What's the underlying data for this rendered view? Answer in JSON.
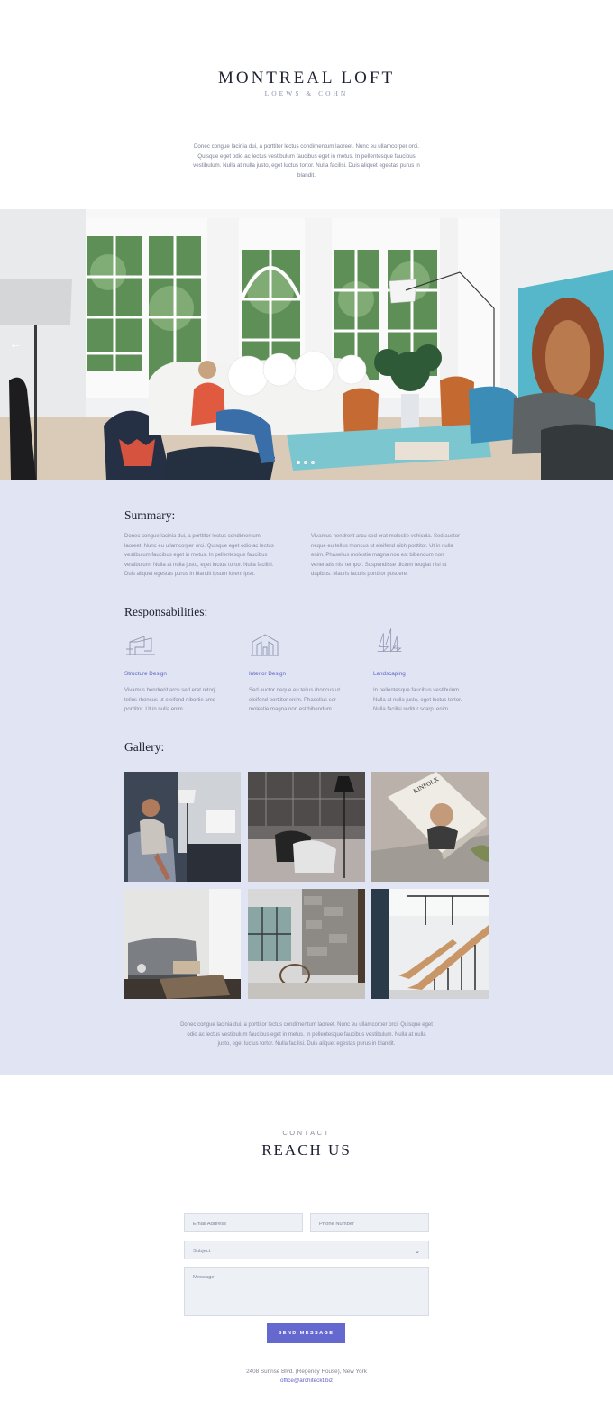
{
  "header": {
    "title": "MONTREAL LOFT",
    "subtitle": "LOEWS & COHN",
    "intro": "Donec congue lacinia dui, a porttitor lectus condimentum laoreet. Nunc eu ullamcorper orci. Quisque eget odio ac lectus vestibulum faucibus eget in metus. In pellentesque faucibus vestibulum. Nulla at nulla justo, eget luctus tortor. Nulla facilisi. Duis aliquet egestas purus in blandit."
  },
  "hero": {
    "prev_icon": "arrow-left-icon",
    "slide_count": 3,
    "active_slide": 1
  },
  "summary": {
    "heading": "Summary:",
    "col1": "Donec congue lacinia dui, a porttitor lectus condimentum laoreet. Nunc eu ullamcorper orci. Quisque eget odio ac lectus vestibulum faucibus eget in metus. In pellentesque faucibus vestibulum. Nulla at nulla justo, eget luctus tortor. Nulla facilisi. Duis aliquet egestas purus in blandit ipsum lorem ipsu.",
    "col2": "Vivamus hendrerit arcu sed erat molestie vehicula. Sed auctor neque eu tellus rhoncus ut eleifend nibh porttitor. Ut in nulla enim. Phasellus molestie magna non est bibendum non venenatis nisl tempor. Suspendisse dictum feugiat nisl ut dapibus. Mauris iaculis porttitor posuere."
  },
  "responsibilities": {
    "heading": "Responsabilities:",
    "items": [
      {
        "icon": "structure-icon",
        "title": "Structure Design",
        "text": "Vivamus hendrerit arcu sed erat retorj tellus rhoncus ut eleifend nibortie amd porttitor. Ut in nulla enim."
      },
      {
        "icon": "interior-house-icon",
        "title": "Interior Design",
        "text": "Sed auctor neque eu tellus rhoncus ut eleifend porttitor enim. Phasellus ser molestie magna non est bibendum."
      },
      {
        "icon": "trees-icon",
        "title": "Landscaping",
        "text": "In pellentesque faucibus vestibulum. Nulla at nulla justo, eget luctus tortor. Nulla facilisi reditur scarp. enim."
      }
    ]
  },
  "gallery": {
    "heading": "Gallery:",
    "book_title": "KINFOLK",
    "outro": "Donec congue lacinia dui, a porttitor lectus condimentum laoreet. Nunc eu ullamcorper orci. Quisque eget odio ac lectus vestibulum faucibus eget in metus. In pellentesque faucibus vestibulum. Nulla at nulla justo, eget luctus tortor. Nulla facilisi. Duis aliquet egestas purus in blandit."
  },
  "contact": {
    "kicker": "CONTACT",
    "title": "REACH US",
    "email_placeholder": "Email Address",
    "phone_placeholder": "Phone Number",
    "subject_placeholder": "Subject",
    "message_placeholder": "Message",
    "send_label": "SEND MESSAGE",
    "address": "2408 Sunrise Blvd. (Regency House), New York",
    "email": "office@architeckt.biz"
  },
  "colors": {
    "accent": "#6468cf",
    "section_bg": "#e0e4f3",
    "field_bg": "#edf0f5",
    "heading": "#1d2030"
  }
}
